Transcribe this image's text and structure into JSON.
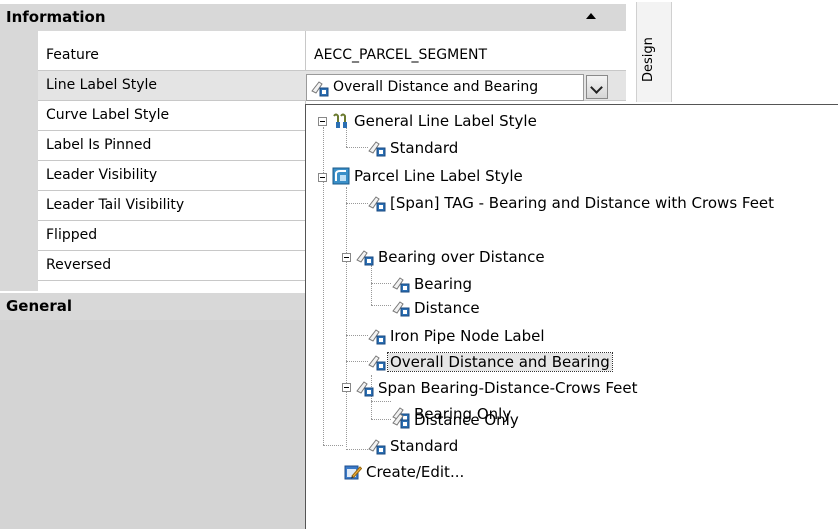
{
  "palette": {
    "section_information": "Information",
    "section_general": "General",
    "design_tab": "Design",
    "properties": [
      {
        "name": "Feature",
        "value": "AECC_PARCEL_SEGMENT"
      },
      {
        "name": "Line Label Style",
        "value": "Overall Distance and Bearing"
      },
      {
        "name": "Curve Label Style",
        "value": ""
      },
      {
        "name": "Label Is Pinned",
        "value": ""
      },
      {
        "name": "Leader Visibility",
        "value": ""
      },
      {
        "name": "Leader Tail Visibility",
        "value": ""
      },
      {
        "name": "Flipped",
        "value": ""
      },
      {
        "name": "Reversed",
        "value": ""
      }
    ]
  },
  "dropdown": {
    "items": [
      {
        "label": "General Line Label Style",
        "icon": "label-style-group-icon"
      },
      {
        "label": "Standard",
        "icon": "label-style-icon"
      },
      {
        "label": "Parcel Line Label Style",
        "icon": "parcel-style-icon"
      },
      {
        "label": "[Span] TAG - Bearing and Distance with Crows Feet",
        "icon": "label-style-icon"
      },
      {
        "label": "Bearing over Distance",
        "icon": "label-style-icon"
      },
      {
        "label": "Bearing",
        "icon": "label-style-icon"
      },
      {
        "label": "Distance",
        "icon": "label-style-icon"
      },
      {
        "label": "Iron Pipe Node Label",
        "icon": "label-style-icon"
      },
      {
        "label": "Overall Distance and Bearing",
        "icon": "label-style-icon",
        "selected": true
      },
      {
        "label": "Span Bearing-Distance-Crows Feet",
        "icon": "label-style-icon"
      },
      {
        "label": "Bearing Only",
        "icon": "label-style-icon"
      },
      {
        "label": "Distance Only",
        "icon": "label-style-icon"
      },
      {
        "label": "Standard",
        "icon": "label-style-icon"
      },
      {
        "label": "Create/Edit...",
        "icon": "edit-pencil-icon"
      }
    ]
  },
  "colors": {
    "section_bg": "#d8d8d8",
    "selection_bg": "#e6e6e6",
    "icon_blue": "#2b6fb3"
  }
}
